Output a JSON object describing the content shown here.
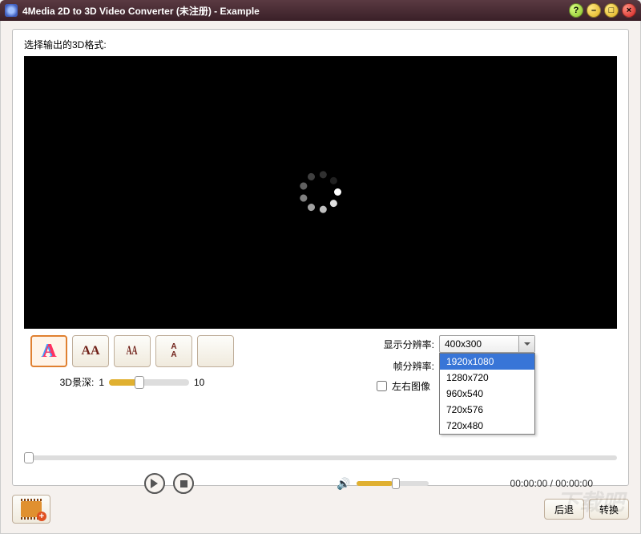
{
  "title": "4Media 2D to 3D Video Converter (未注册) - Example",
  "label_output_format": "选择输出的3D格式:",
  "depth": {
    "label": "3D景深:",
    "min": "1",
    "max": "10"
  },
  "settings": {
    "resolution_label": "显示分辨率:",
    "resolution_value": "400x300",
    "framerate_label": "帧分辨率:",
    "swap_label": "左右图像",
    "resolution_options": [
      "1920x1080",
      "1280x720",
      "960x540",
      "720x576",
      "720x480"
    ]
  },
  "time": {
    "current": "00:00:00",
    "separator": " / ",
    "total": "00:00:00"
  },
  "footer": {
    "back": "后退",
    "convert": "转换"
  },
  "win": {
    "help": "?",
    "min": "–",
    "max": "□",
    "close": "×"
  }
}
